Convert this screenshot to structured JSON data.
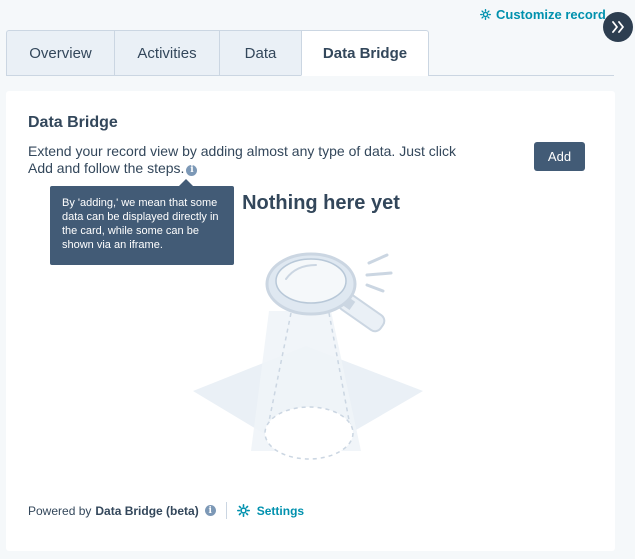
{
  "header": {
    "customize_label": "Customize record",
    "expand_icon": "double-chevron-right-icon"
  },
  "tabs": [
    {
      "label": "Overview",
      "active": false
    },
    {
      "label": "Activities",
      "active": false
    },
    {
      "label": "Data",
      "active": false
    },
    {
      "label": "Data Bridge",
      "active": true
    }
  ],
  "card": {
    "title": "Data Bridge",
    "description": "Extend your record view by adding almost any type of data. Just click Add and follow the steps.",
    "add_label": "Add",
    "empty_title": "Nothing here yet",
    "tooltip": "By 'adding,' we mean that some data can be displayed directly in the card, while some can be shown via an iframe."
  },
  "footer": {
    "powered_by": "Powered by",
    "product": "Data Bridge (beta)",
    "settings_label": "Settings"
  },
  "colors": {
    "accent_link": "#0091ae",
    "button_dark": "#425b76",
    "text": "#33475b",
    "tab_inactive_bg": "#eaf0f6"
  }
}
